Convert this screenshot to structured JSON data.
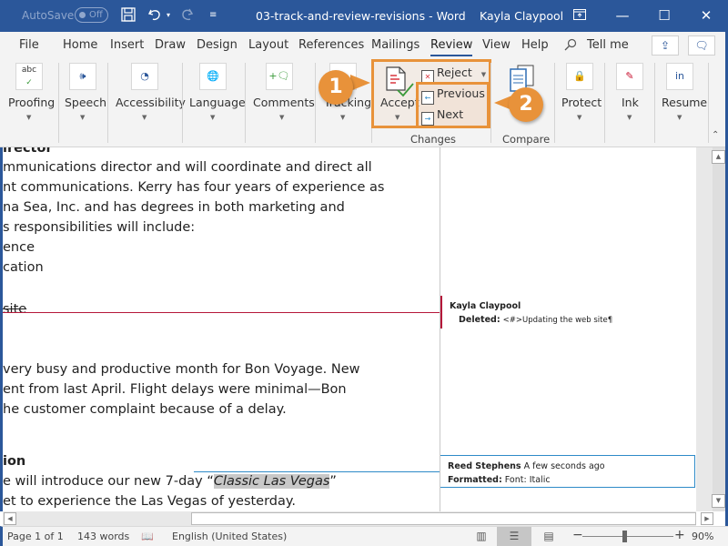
{
  "titlebar": {
    "autosave_label": "AutoSave",
    "autosave_state": "Off",
    "doc_title": "03-track-and-review-revisions - Word",
    "user_name": "Kayla Claypool",
    "quick_access": [
      "save-icon",
      "undo-icon",
      "redo-icon",
      "customize-icon"
    ]
  },
  "tabs": [
    {
      "label": "File"
    },
    {
      "label": "Home"
    },
    {
      "label": "Insert"
    },
    {
      "label": "Draw"
    },
    {
      "label": "Design"
    },
    {
      "label": "Layout"
    },
    {
      "label": "References"
    },
    {
      "label": "Mailings"
    },
    {
      "label": "Review",
      "active": true
    },
    {
      "label": "View"
    },
    {
      "label": "Help"
    }
  ],
  "tell_me": "Tell me",
  "ribbon": {
    "proofing": "Proofing",
    "speech": "Speech",
    "accessibility": "Accessibility",
    "language": "Language",
    "comments": "Comments",
    "tracking": "Tracking",
    "accept": "Accept",
    "reject": "Reject",
    "previous": "Previous",
    "next": "Next",
    "changes_group": "Changes",
    "compare_group": "Compare",
    "protect": "Protect",
    "ink": "Ink",
    "resume": "Resume"
  },
  "callouts": {
    "one": "1",
    "two": "2",
    "color": "#e8923a"
  },
  "document": {
    "lines": [
      "irector",
      "mmunications director and will coordinate and direct all",
      "nt communications. Kerry has four years of experience as",
      "na Sea, Inc. and has degrees in both marketing and",
      "s responsibilities will include:",
      "ence",
      "cation"
    ],
    "deleted_text": "site",
    "para2": [
      "very busy and productive month for Bon Voyage. New",
      "ent from last April. Flight delays were minimal—Bon",
      "he customer complaint because of a delay."
    ],
    "heading3": "ion",
    "line_before": "e will introduce our new 7-day “",
    "italic_text": "Classic Las Vegas",
    "line_after": "”",
    "last_line": "et to experience the Las Vegas of yesterday."
  },
  "markup": {
    "balloon1": {
      "author": "Kayla Claypool",
      "action": "Deleted:",
      "detail": "<#>Updating the web site¶"
    },
    "balloon2": {
      "author": "Reed Stephens",
      "time": "A few seconds ago",
      "action": "Formatted:",
      "detail": "Font: Italic"
    },
    "deletion_color": "#b5173a",
    "format_color": "#2e8ac8"
  },
  "statusbar": {
    "page": "Page 1 of 1",
    "words": "143 words",
    "language": "English (United States)",
    "zoom": "90%",
    "zoom_percent": 90
  },
  "colors": {
    "brand": "#2b579a",
    "highlight": "#e8923a"
  }
}
